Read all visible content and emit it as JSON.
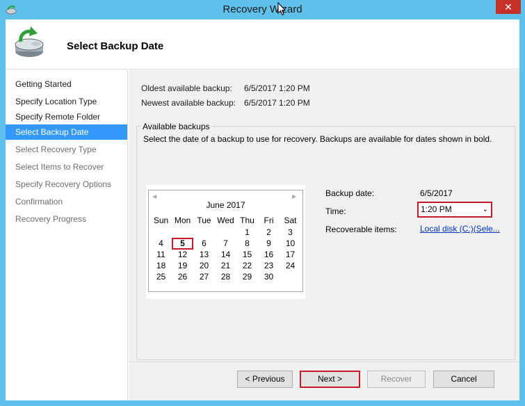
{
  "window": {
    "title": "Recovery Wizard",
    "close_glyph": "✕"
  },
  "header": {
    "title": "Select Backup Date"
  },
  "nav": {
    "items": [
      {
        "label": "Getting Started",
        "state": "done"
      },
      {
        "label": "Specify Location Type",
        "state": "done"
      },
      {
        "label": "Specify Remote Folder",
        "state": "done"
      },
      {
        "label": "Select Backup Date",
        "state": "active"
      },
      {
        "label": "Select Recovery Type",
        "state": "todo"
      },
      {
        "label": "Select Items to Recover",
        "state": "todo"
      },
      {
        "label": "Specify Recovery Options",
        "state": "todo"
      },
      {
        "label": "Confirmation",
        "state": "todo"
      },
      {
        "label": "Recovery Progress",
        "state": "todo"
      }
    ]
  },
  "info": {
    "oldest_label": "Oldest available backup:",
    "oldest_value": "6/5/2017 1:20 PM",
    "newest_label": "Newest available backup:",
    "newest_value": "6/5/2017 1:20 PM"
  },
  "available": {
    "legend": "Available backups",
    "description": "Select the date of a backup to use for recovery. Backups are available for dates shown in bold."
  },
  "calendar": {
    "month_label": "June 2017",
    "prev_glyph": "◀",
    "next_glyph": "▶",
    "weekdays": [
      "Sun",
      "Mon",
      "Tue",
      "Wed",
      "Thu",
      "Fri",
      "Sat"
    ],
    "weeks": [
      [
        "",
        "",
        "",
        "",
        "1",
        "2",
        "3"
      ],
      [
        "4",
        "5",
        "6",
        "7",
        "8",
        "9",
        "10"
      ],
      [
        "11",
        "12",
        "13",
        "14",
        "15",
        "16",
        "17"
      ],
      [
        "18",
        "19",
        "20",
        "21",
        "22",
        "23",
        "24"
      ],
      [
        "25",
        "26",
        "27",
        "28",
        "29",
        "30",
        ""
      ]
    ],
    "selected_day": "5"
  },
  "details": {
    "backup_date_label": "Backup date:",
    "backup_date_value": "6/5/2017",
    "time_label": "Time:",
    "time_value": "1:20 PM",
    "recoverable_label": "Recoverable items:",
    "recoverable_link": "Local disk (C:)(Sele..."
  },
  "buttons": {
    "previous": "< Previous",
    "next": "Next >",
    "recover": "Recover",
    "cancel": "Cancel"
  },
  "colors": {
    "accent": "#3399ff",
    "highlight_border": "#c8192b",
    "titlebar": "#5fc0ea",
    "link": "#0033cc"
  }
}
